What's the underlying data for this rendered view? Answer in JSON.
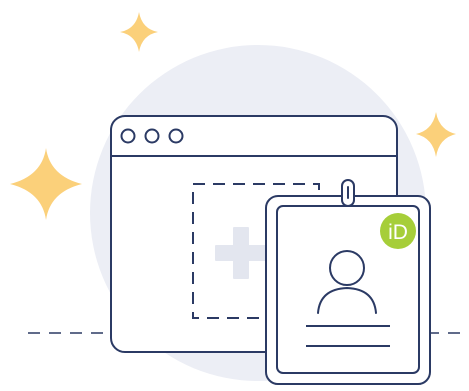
{
  "illustration": {
    "badge_text": "iD",
    "colors": {
      "outline": "#2b3a64",
      "backdrop": "#eceef5",
      "card_fill": "#ffffff",
      "plus": "#e3e6ef",
      "sparkle": "#fbd07a",
      "orcid_green": "#a6ce39",
      "badge_text": "#ffffff"
    },
    "icons": [
      "sparkle-icon",
      "browser-window-icon",
      "add-placeholder-icon",
      "id-badge-icon",
      "user-avatar-icon",
      "orcid-logo-icon"
    ]
  }
}
